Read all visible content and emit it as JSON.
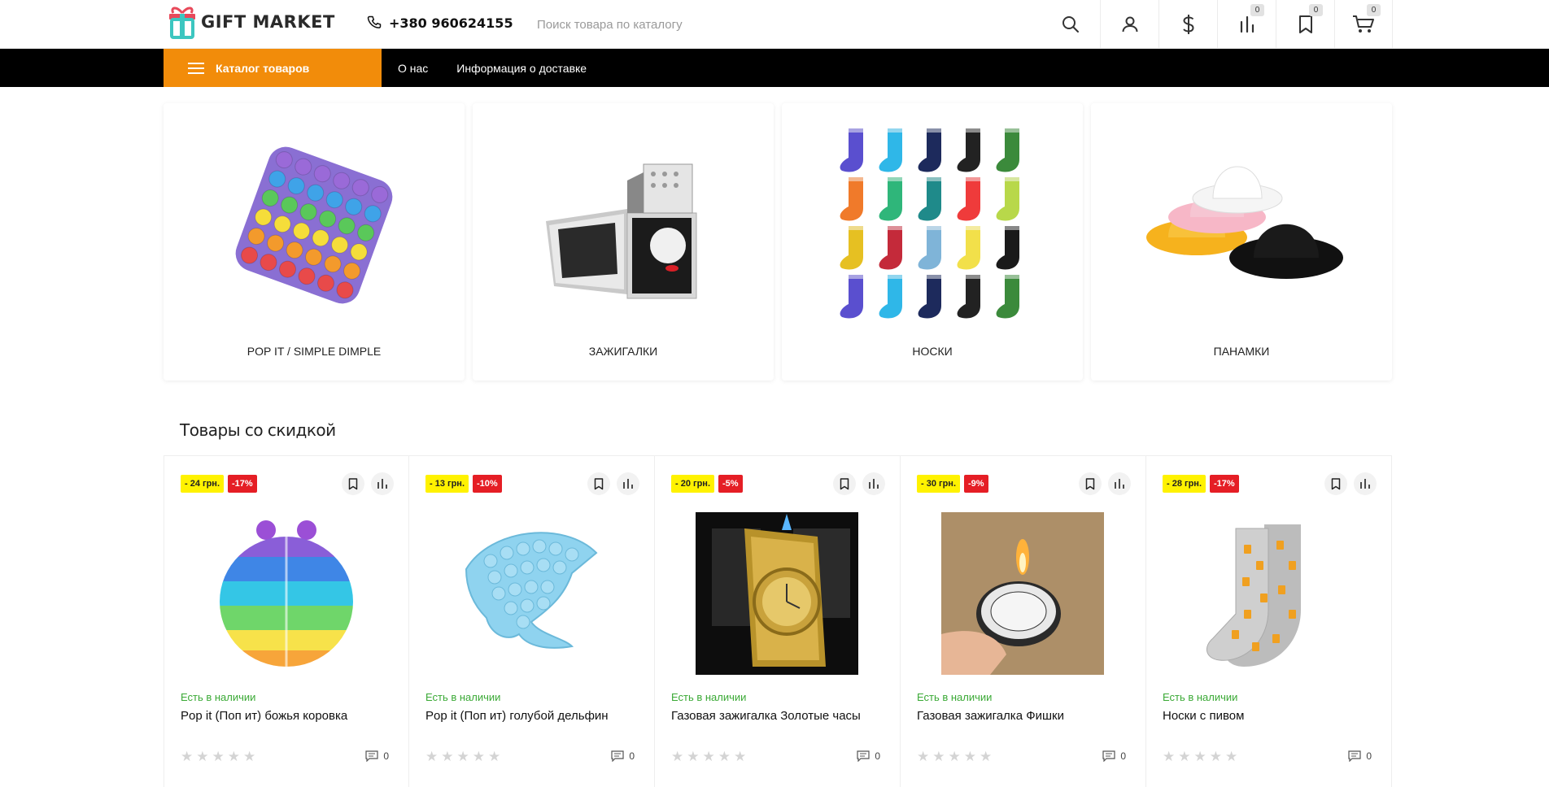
{
  "header": {
    "logo_text": "GIFT MARKET",
    "phone": "+380 960624155",
    "search_placeholder": "Поиск товара по каталогу",
    "compare_count": "0",
    "wishlist_count": "0",
    "cart_count": "0"
  },
  "nav": {
    "catalog_label": "Каталог товаров",
    "links": [
      "О нас",
      "Информация о доставке"
    ]
  },
  "categories": [
    {
      "name": "POP IT / SIMPLE DIMPLE",
      "icon": "pop-it-image"
    },
    {
      "name": "Зажигалки",
      "icon": "lighter-image"
    },
    {
      "name": "Носки",
      "icon": "socks-image"
    },
    {
      "name": "Панамки",
      "icon": "bucket-hats-image"
    }
  ],
  "section": {
    "discount_title": "Товары со скидкой"
  },
  "products": [
    {
      "discount_amount": "- 24 грн.",
      "discount_percent": "-17%",
      "stock": "Есть в наличии",
      "name": "Pop it (Поп ит) божья коровка",
      "reviews": "0"
    },
    {
      "discount_amount": "- 13 грн.",
      "discount_percent": "-10%",
      "stock": "Есть в наличии",
      "name": "Pop it (Поп ит) голубой дельфин",
      "reviews": "0"
    },
    {
      "discount_amount": "- 20 грн.",
      "discount_percent": "-5%",
      "stock": "Есть в наличии",
      "name": "Газовая зажигалка Золотые часы",
      "reviews": "0"
    },
    {
      "discount_amount": "- 30 грн.",
      "discount_percent": "-9%",
      "stock": "Есть в наличии",
      "name": "Газовая зажигалка Фишки",
      "reviews": "0"
    },
    {
      "discount_amount": "- 28 грн.",
      "discount_percent": "-17%",
      "stock": "Есть в наличии",
      "name": "Носки с пивом",
      "reviews": "0"
    }
  ],
  "colors": {
    "accent_orange": "#f28c0a",
    "nav_black": "#000000",
    "stock_green": "#3aa935",
    "tag_yellow": "#fff200",
    "tag_red": "#e51e25"
  }
}
